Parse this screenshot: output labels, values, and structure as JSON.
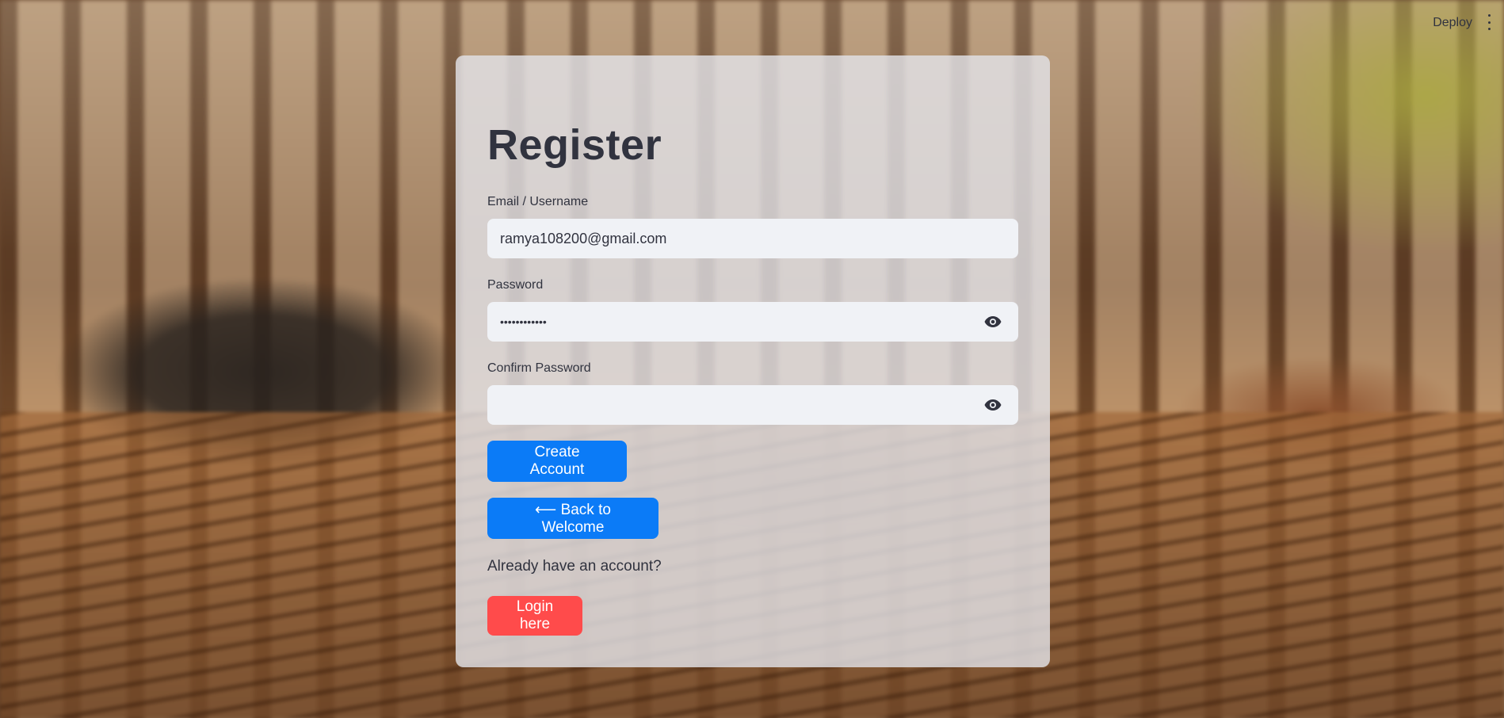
{
  "header": {
    "deploy_label": "Deploy"
  },
  "register": {
    "title": "Register",
    "email": {
      "label": "Email / Username",
      "value": "ramya108200@gmail.com"
    },
    "password": {
      "label": "Password",
      "value": "••••••••••••"
    },
    "confirm_password": {
      "label": "Confirm Password",
      "value": ""
    },
    "create_account_label": "Create Account",
    "back_label": "⟵ Back to Welcome",
    "already_text": "Already have an account?",
    "login_label": "Login here"
  },
  "colors": {
    "primary_button": "#0b7bf7",
    "login_button": "#ff4b4b",
    "input_bg": "#f0f2f6",
    "text": "#31333f"
  },
  "icons": [
    "eye-icon",
    "menu-dots-icon",
    "left-arrow-icon"
  ]
}
